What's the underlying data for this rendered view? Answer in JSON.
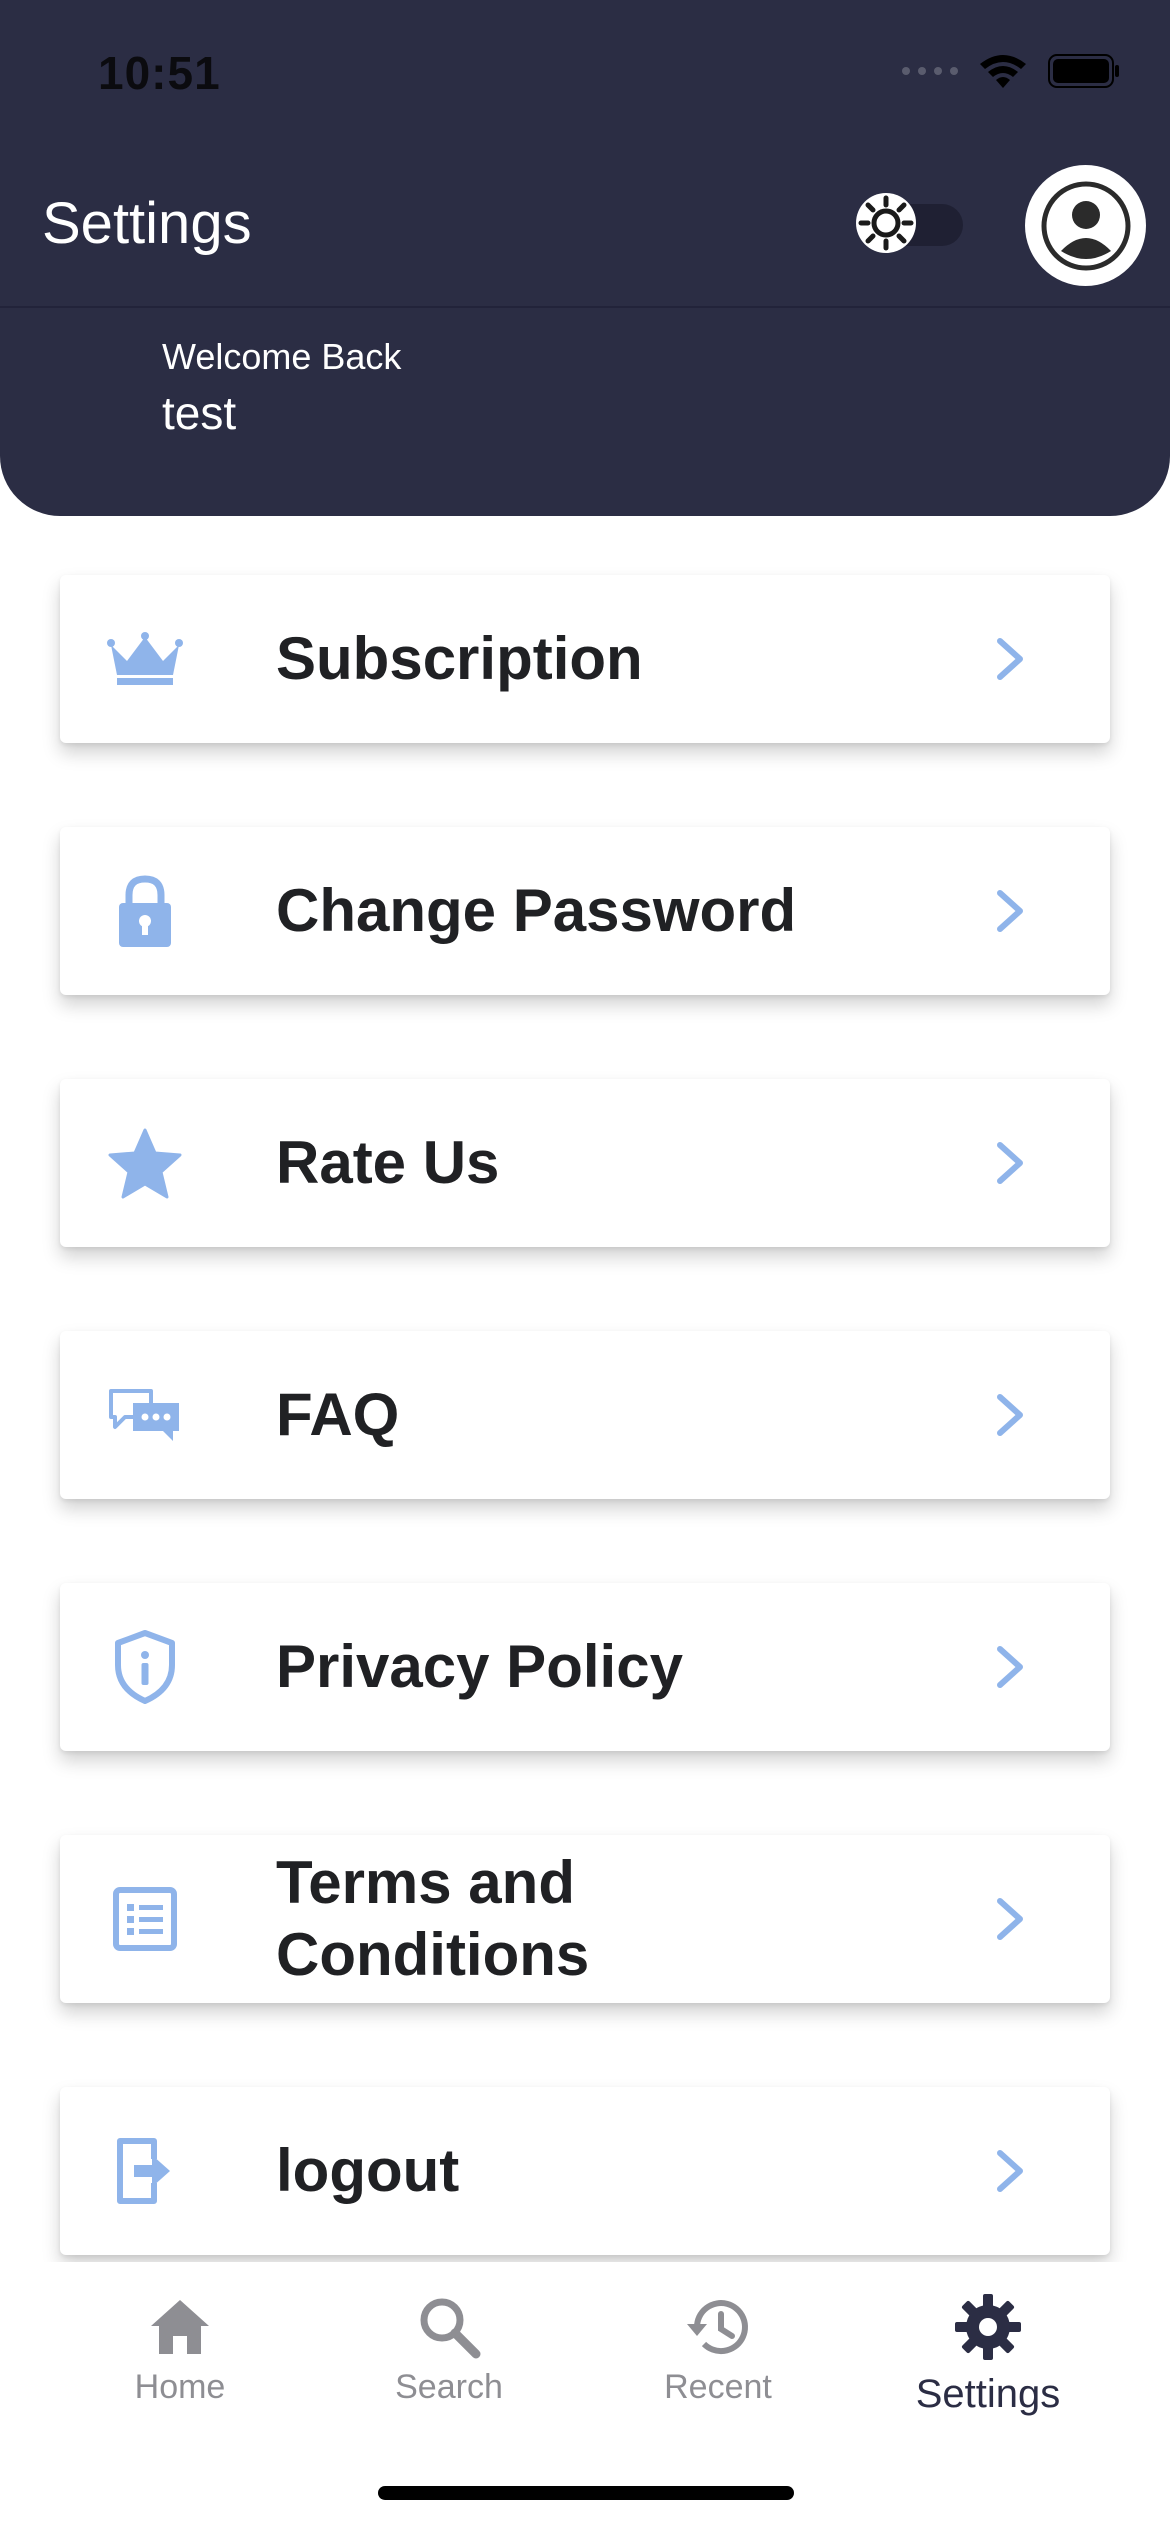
{
  "status_bar": {
    "time": "10:51"
  },
  "header": {
    "title": "Settings",
    "welcome_label": "Welcome Back",
    "user_name": "test"
  },
  "menu": {
    "items": [
      {
        "label": "Subscription",
        "icon": "crown-icon"
      },
      {
        "label": "Change Password",
        "icon": "lock-icon"
      },
      {
        "label": "Rate Us",
        "icon": "star-icon"
      },
      {
        "label": "FAQ",
        "icon": "chat-bubbles-icon"
      },
      {
        "label": "Privacy Policy",
        "icon": "shield-info-icon"
      },
      {
        "label": "Terms and Conditions",
        "icon": "list-document-icon"
      },
      {
        "label": "logout",
        "icon": "logout-icon"
      }
    ]
  },
  "tabbar": {
    "tabs": [
      {
        "label": "Home",
        "icon": "home-icon"
      },
      {
        "label": "Search",
        "icon": "search-icon"
      },
      {
        "label": "Recent",
        "icon": "history-icon"
      },
      {
        "label": "Settings",
        "icon": "gear-icon",
        "active": true
      }
    ]
  },
  "colors": {
    "header_bg": "#2b2d44",
    "accent_icon": "#8fb4ea",
    "text_dark": "#202124",
    "tab_inactive": "#8e8e93"
  }
}
